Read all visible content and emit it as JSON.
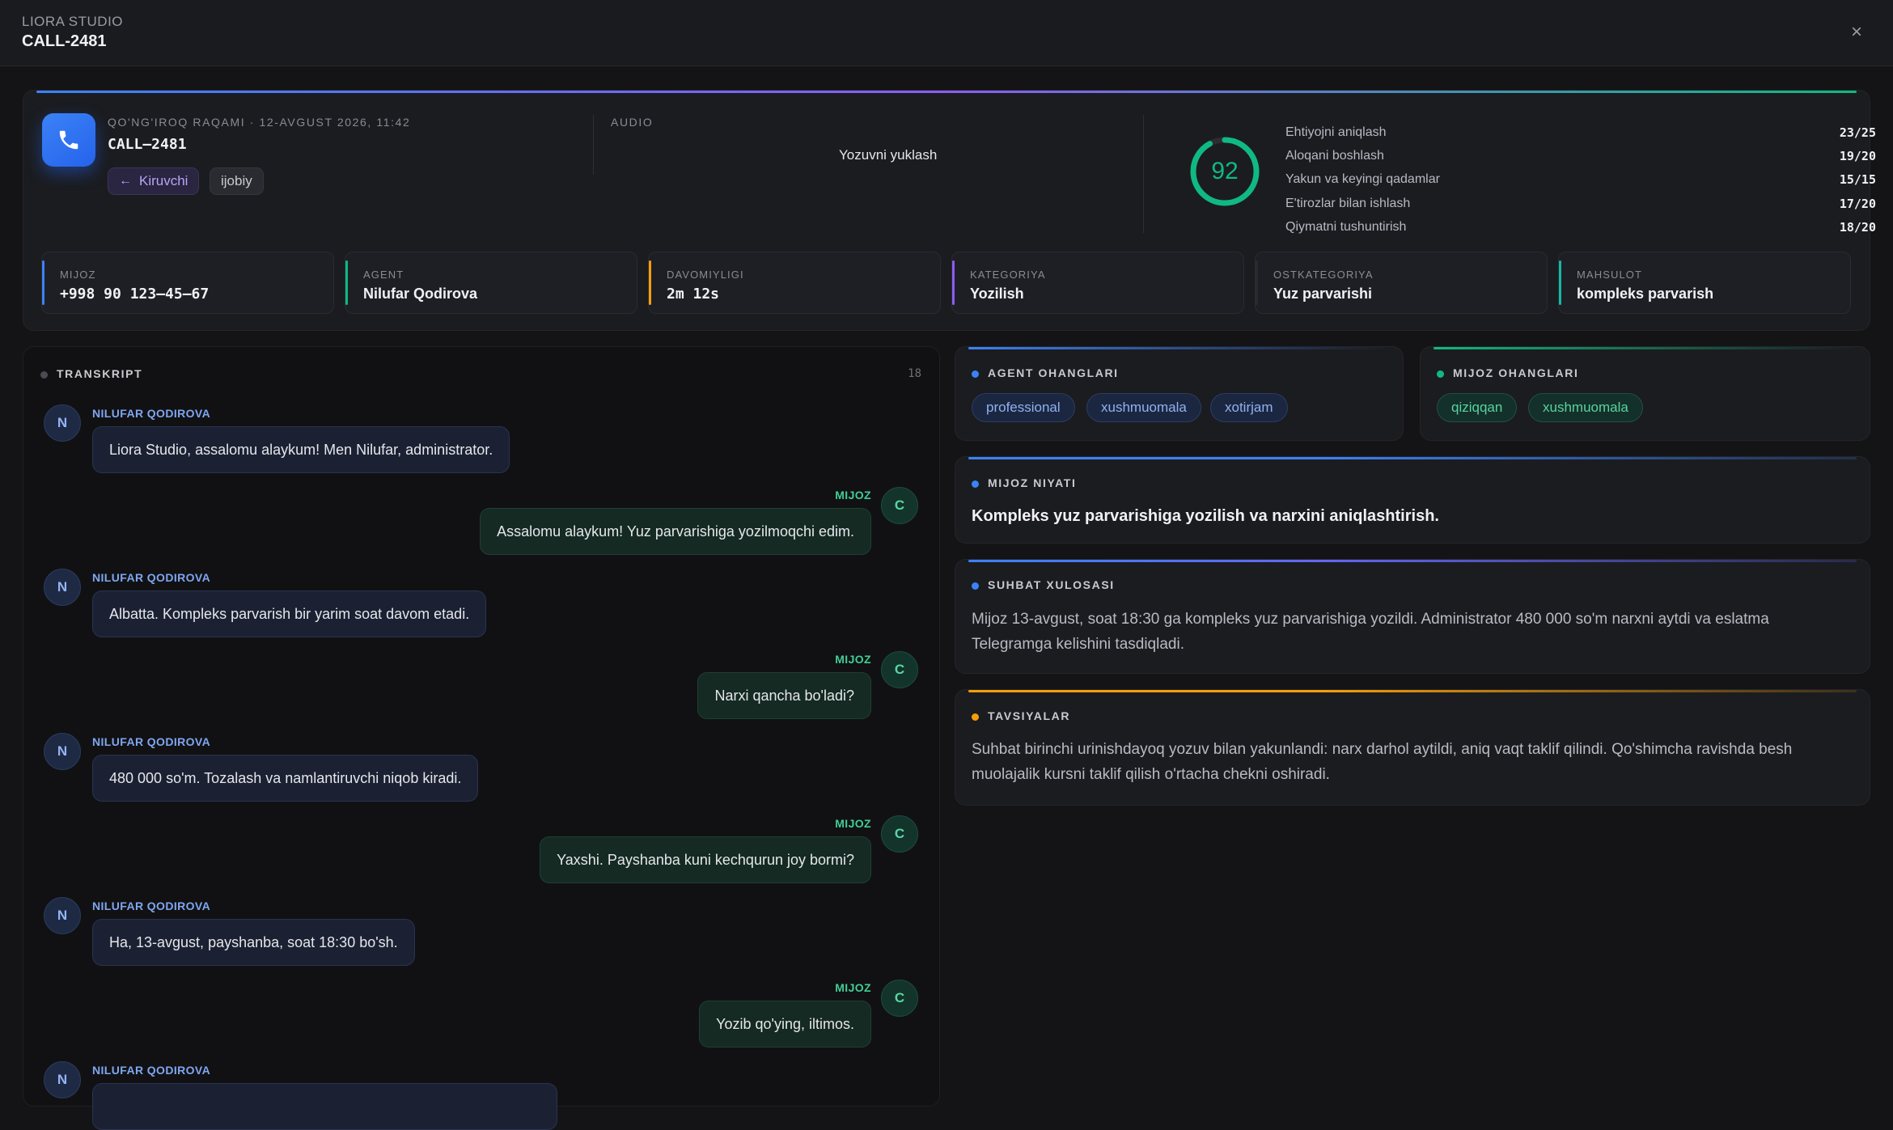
{
  "header": {
    "studio": "LIORA STUDIO",
    "call_id": "CALL-2481",
    "close_label": "×"
  },
  "hero": {
    "meta_label": "QO'NG'IROQ RAQAMI · 12-AVGUST 2026, 11:42",
    "call_id": "CALL–2481",
    "direction_chip": "Kiruvchi",
    "sentiment_chip": "ijobiy",
    "audio_label": "AUDIO",
    "audio_action": "Yozuvni yuklash",
    "score": "92",
    "score_fraction": 0.92,
    "criteria": [
      {
        "name": "Ehtiyojni aniqlash",
        "value": "23/25"
      },
      {
        "name": "Aloqani boshlash",
        "value": "19/20"
      },
      {
        "name": "Yakun va keyingi qadamlar",
        "value": "15/15"
      },
      {
        "name": "E'tirozlar bilan ishlash",
        "value": "17/20"
      },
      {
        "name": "Qiymatni tushuntirish",
        "value": "18/20"
      }
    ],
    "stats": [
      {
        "label": "MIJOZ",
        "value": "+998 90 123–45–67",
        "color": "#3b82f6"
      },
      {
        "label": "AGENT",
        "value": "Nilufar Qodirova",
        "color": "#10b981"
      },
      {
        "label": "DAVOMIYLIGI",
        "value": "2m 12s",
        "color": "#f59e0b"
      },
      {
        "label": "KATEGORIYA",
        "value": "Yozilish",
        "color": "#8b5cf6"
      },
      {
        "label": "OSTKATEGORIYA",
        "value": "Yuz parvarishi",
        "color": "#2a2b31"
      },
      {
        "label": "MAHSULOT",
        "value": "kompleks parvarish",
        "color": "#14b8a6"
      }
    ]
  },
  "transcript": {
    "title": "TRANSKRIPT",
    "count": "18",
    "messages": [
      {
        "role": "agent",
        "initial": "N",
        "speaker": "NILUFAR QODIROVA",
        "text": "Liora Studio, assalomu alaykum! Men Nilufar, administrator."
      },
      {
        "role": "client",
        "initial": "C",
        "speaker": "MIJOZ",
        "text": "Assalomu alaykum! Yuz parvarishiga yozilmoqchi edim."
      },
      {
        "role": "agent",
        "initial": "N",
        "speaker": "NILUFAR QODIROVA",
        "text": "Albatta. Kompleks parvarish bir yarim soat davom etadi."
      },
      {
        "role": "client",
        "initial": "C",
        "speaker": "MIJOZ",
        "text": "Narxi qancha bo'ladi?"
      },
      {
        "role": "agent",
        "initial": "N",
        "speaker": "NILUFAR QODIROVA",
        "text": "480 000 so'm. Tozalash va namlantiruvchi niqob kiradi."
      },
      {
        "role": "client",
        "initial": "C",
        "speaker": "MIJOZ",
        "text": "Yaxshi. Payshanba kuni kechqurun joy bormi?"
      },
      {
        "role": "agent",
        "initial": "N",
        "speaker": "NILUFAR QODIROVA",
        "text": "Ha, 13-avgust, payshanba, soat 18:30 bo'sh."
      },
      {
        "role": "client",
        "initial": "C",
        "speaker": "MIJOZ",
        "text": "Yozib qo'ying, iltimos."
      },
      {
        "role": "agent",
        "initial": "N",
        "speaker": "NILUFAR QODIROVA",
        "text": ""
      }
    ]
  },
  "agent_tones": {
    "title": "AGENT OHANGLARI",
    "tags": [
      "professional",
      "xushmuomala",
      "xotirjam"
    ]
  },
  "client_tones": {
    "title": "MIJOZ OHANGLARI",
    "tags": [
      "qiziqqan",
      "xushmuomala"
    ]
  },
  "intent": {
    "title": "MIJOZ NIYATI",
    "text": "Kompleks yuz parvarishiga yozilish va narxini aniqlashtirish."
  },
  "summary": {
    "title": "SUHBAT XULOSASI",
    "text": "Mijoz 13-avgust, soat 18:30 ga kompleks yuz parvarishiga yozildi. Administrator 480 000 so'm narxni aytdi va eslatma Telegramga kelishini tasdiqladi."
  },
  "recommendations": {
    "title": "TAVSIYALAR",
    "text": "Suhbat birinchi urinishdayoq yozuv bilan yakunlandi: narx darhol aytildi, aniq vaqt taklif qilindi. Qo'shimcha ravishda besh muolajalik kursni taklif qilish o'rtacha chekni oshiradi."
  },
  "colors": {
    "accent_blue": "#3b82f6",
    "accent_green": "#10b981",
    "accent_orange": "#f59e0b",
    "accent_purple": "#8b5cf6"
  },
  "icons": {
    "phone": "phone-icon",
    "arrow": "arrow-left-icon",
    "close": "close-icon"
  }
}
